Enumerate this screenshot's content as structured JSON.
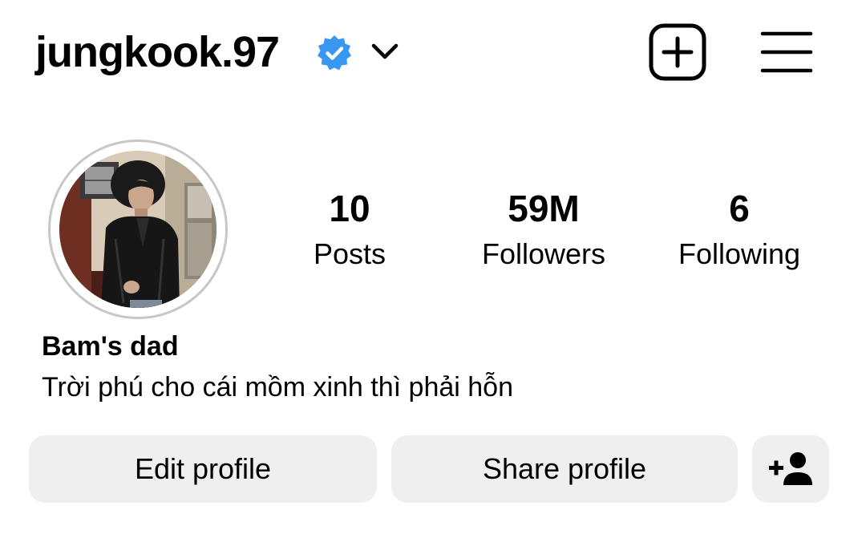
{
  "header": {
    "username": "jungkook.97",
    "verified_icon": "verified-badge-icon",
    "account_switch_icon": "chevron-down-icon",
    "new_post_icon": "plus-square-icon",
    "menu_icon": "hamburger-menu-icon"
  },
  "profile": {
    "avatar_icon": "profile-photo",
    "stats": {
      "posts": {
        "value": "10",
        "label": "Posts"
      },
      "followers": {
        "value": "59M",
        "label": "Followers"
      },
      "following": {
        "value": "6",
        "label": "Following"
      }
    },
    "display_name": "Bam's dad",
    "bio": "Trời phú cho cái mồm xinh thì phải hỗn"
  },
  "actions": {
    "edit_profile": "Edit profile",
    "share_profile": "Share profile",
    "discover_people_icon": "person-add-icon"
  },
  "colors": {
    "verified_blue": "#3897f0",
    "button_bg": "#efefef",
    "text": "#000000",
    "avatar_ring": "#c7c7c7"
  }
}
